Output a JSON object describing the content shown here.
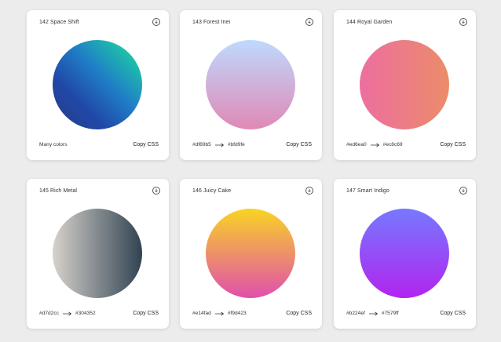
{
  "cards": [
    {
      "title": "142 Space Shift",
      "label": "Many colors",
      "from": "",
      "to": "",
      "copy": "Copy CSS",
      "gradient": [
        "#3f51b1",
        "#5a55ae",
        "#7b5fac",
        "#8f6aae",
        "#a86aa4",
        "#cc6b8e",
        "#f18271",
        "#f3a469",
        "#f7c978"
      ],
      "kind": "space"
    },
    {
      "title": "143 Forest Inei",
      "label": "",
      "from": "#df89b5",
      "to": "#bfd9fe",
      "copy": "Copy CSS",
      "kind": "forest"
    },
    {
      "title": "144 Royal Garden",
      "label": "",
      "from": "#ed6ea0",
      "to": "#ec8c69",
      "copy": "Copy CSS",
      "kind": "royal"
    },
    {
      "title": "145 Rich Metal",
      "label": "",
      "from": "#d7d2cc",
      "to": "#304352",
      "copy": "Copy CSS",
      "kind": "metal"
    },
    {
      "title": "146 Juicy Cake",
      "label": "",
      "from": "#e14fad",
      "to": "#f9d423",
      "copy": "Copy CSS",
      "kind": "juicy"
    },
    {
      "title": "147 Smart Indigo",
      "label": "",
      "from": "#b224ef",
      "to": "#7579ff",
      "copy": "Copy CSS",
      "kind": "indigo"
    }
  ],
  "icons": {
    "download": "download-circle-icon",
    "arrow": "arrow-right-icon"
  }
}
